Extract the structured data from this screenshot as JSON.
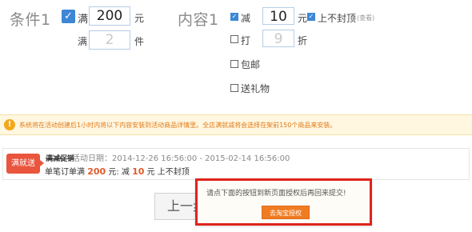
{
  "condition": {
    "title": "条件1",
    "row1": {
      "label": "满",
      "value": "200",
      "unit": "元"
    },
    "row2": {
      "label": "满",
      "placeholder": "2",
      "unit": "件"
    }
  },
  "content": {
    "title": "内容1",
    "reduce": {
      "label": "减",
      "value": "10",
      "unit": "元",
      "nocap_label": "上不封顶",
      "link": "(查看)"
    },
    "discount": {
      "label": "打",
      "placeholder": "9",
      "unit": "折"
    },
    "free_shipping": "包邮",
    "gift": "送礼物"
  },
  "notice": {
    "icon": "!",
    "text": "系统将在活动创建后1小时内将以下内容安装到活动商品详情里。全店满就减将会选择在架前150个商品来安装。"
  },
  "activity": {
    "badge": "满就送",
    "name": "满减促销",
    "date": "活动日期：2014-12-26 16:56:00 - 2015-02-14 16:56:00",
    "detail_prefix": "单笔订单满",
    "amount": "200",
    "detail_mid": "元: 减",
    "discount": "10",
    "detail_suffix": "元 上不封顶"
  },
  "prev_button": "上一步",
  "popup": {
    "message": "请点下面的按钮到新页面授权后再回来提交!",
    "button": "去淘宝授权"
  }
}
